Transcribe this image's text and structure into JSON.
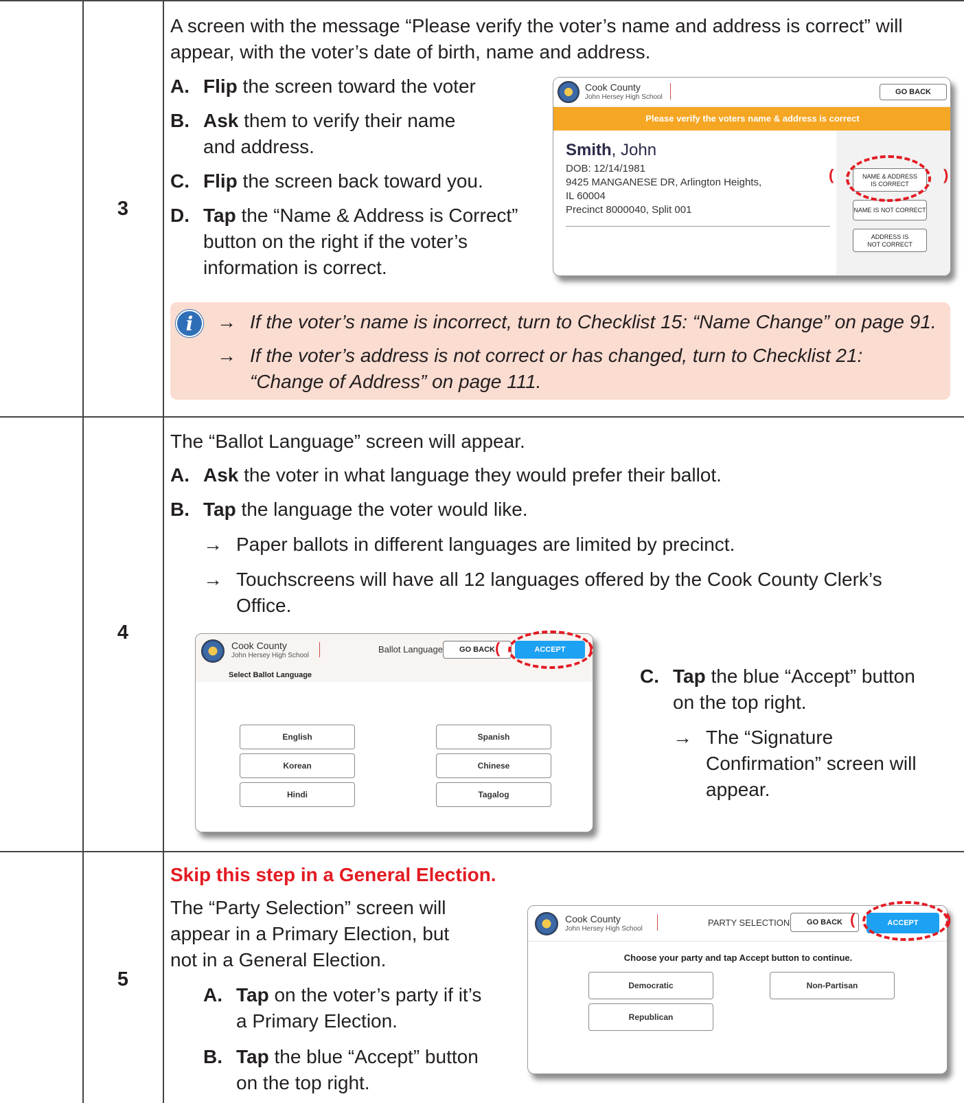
{
  "colors": {
    "rule": "#444444",
    "info_bg": "#fbdcd1",
    "info_icon": "#2f6fb7",
    "banner": "#f5a623",
    "accept_blue": "#1da1f2",
    "highlight_red": "#e31b23"
  },
  "step3": {
    "number": "3",
    "intro_1": "A screen with the message “Please verify the voter’s name and address is correct” will",
    "intro_2": "appear, with the voter’s date of birth, name and address.",
    "items": [
      {
        "letter": "A.",
        "bold": "Flip",
        "rest": " the screen toward the voter"
      },
      {
        "letter": "B.",
        "bold": "Ask",
        "rest": " them to verify their name",
        "rest2": "and address."
      },
      {
        "letter": "C.",
        "bold": "Flip",
        "rest": " the screen back toward you."
      },
      {
        "letter": "D.",
        "bold": "Tap",
        "rest": " the “Name & Address is Correct”",
        "rest2": "button on the right if the voter’s",
        "rest3": "information is correct."
      }
    ],
    "info": {
      "icon": "info-icon",
      "arrow": "→",
      "line1": "If the voter’s name is incorrect, turn to Checklist 15: “Name Change” on page 91.",
      "line2": "If the voter’s address is not correct or has changed, turn to Checklist 21:",
      "line3": "“Change of Address” on page 111."
    },
    "screen": {
      "county": "Cook County",
      "school": "John Hersey High School",
      "go_back": "GO BACK",
      "banner": "Please verify the voters name & address is correct",
      "last_name": "Smith",
      "first_name": ", John",
      "dob": "DOB: 12/14/1981",
      "address_1": "9425 MANGANESE DR, Arlington Heights,",
      "address_2": "IL 60004",
      "precinct": "Precinct 8000040, Split 001",
      "btn_correct_1": "NAME & ADDRESS",
      "btn_correct_2": "IS CORRECT",
      "btn_name_not": "NAME IS NOT CORRECT",
      "btn_addr_not_1": "ADDRESS IS",
      "btn_addr_not_2": "NOT CORRECT",
      "paren_left": "(",
      "paren_right": ")"
    }
  },
  "step4": {
    "number": "4",
    "intro": "The “Ballot Language” screen will appear.",
    "items": [
      {
        "letter": "A.",
        "bold": "Ask",
        "rest": " the voter in what language they would prefer their ballot."
      },
      {
        "letter": "B.",
        "bold": "Tap",
        "rest": " the language the voter would like."
      }
    ],
    "arrow": "→",
    "bullet_1": "Paper ballots in different languages are limited by precinct.",
    "bullet_2a": "Touchscreens will have all 12 languages offered by the Cook County Clerk’s",
    "bullet_2b": "Office.",
    "item_c": {
      "letter": "C.",
      "bold": "Tap",
      "rest": " the blue  “Accept” button",
      "rest2": "on the top right."
    },
    "sub_1": "The “Signature",
    "sub_2": "Confirmation” screen will",
    "sub_3": "appear.",
    "screen": {
      "county": "Cook County",
      "school": "John Hersey High School",
      "title": "Ballot Language",
      "go_back": "GO BACK",
      "accept": "ACCEPT",
      "select_label": "Select Ballot Language",
      "languages": [
        "English",
        "Spanish",
        "Korean",
        "Chinese",
        "Hindi",
        "Tagalog"
      ],
      "paren_left": "(",
      "paren_right": ")"
    }
  },
  "step5": {
    "number": "5",
    "skip": "Skip this step in a General Election.",
    "intro_1": "The “Party Selection” screen will",
    "intro_2": "appear in a Primary Election, but",
    "intro_3": "not in a General Election.",
    "items": [
      {
        "letter": "A.",
        "bold": "Tap",
        "rest": " on the voter’s party if it’s",
        "rest2": "a Primary Election."
      },
      {
        "letter": "B.",
        "bold": "Tap",
        "rest": " the blue  “Accept” button",
        "rest2": "on the top right."
      }
    ],
    "screen": {
      "county": "Cook County",
      "school": "John Hersey High School",
      "title": "PARTY SELECTION",
      "go_back": "GO BACK",
      "accept": "ACCEPT",
      "prompt": "Choose your party and tap Accept button to continue.",
      "parties": [
        "Democratic",
        "Non-Partisan",
        "Republican"
      ],
      "paren_left": "(",
      "paren_right": ")"
    }
  }
}
